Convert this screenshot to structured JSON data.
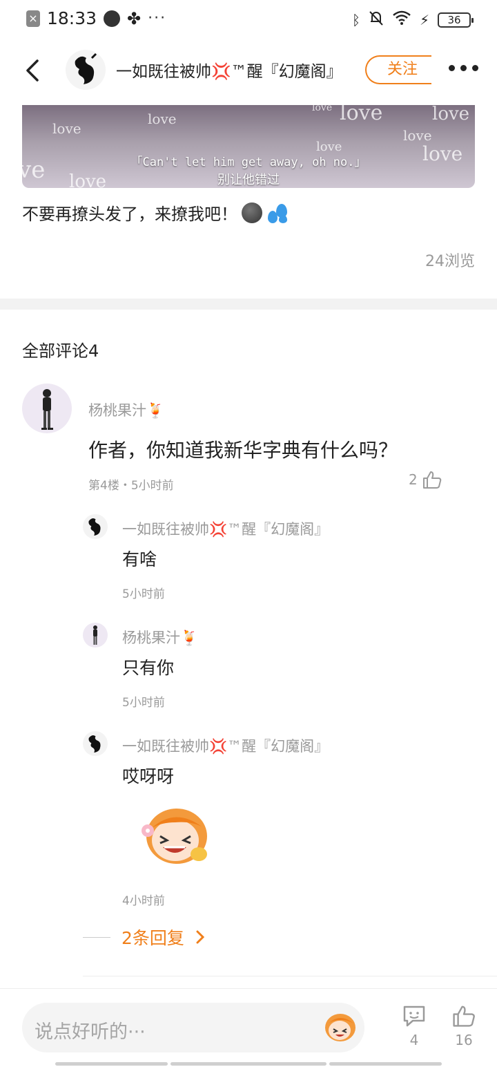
{
  "status_bar": {
    "time": "18:33",
    "battery": "36"
  },
  "header": {
    "author": "一如既往被帅💢™醒『幻魔阁』",
    "follow_label": "关注"
  },
  "post": {
    "subtitle_en": "「Can't let him get away, oh no.」",
    "subtitle_zh": "别让他错过",
    "caption": "不要再撩头发了，来撩我吧！",
    "views": "24浏览"
  },
  "comments_section": {
    "title": "全部评论4"
  },
  "comment": {
    "author": "杨桃果汁🍹",
    "text": "作者，你知道我新华字典有什么吗？",
    "meta": "第4楼・5小时前",
    "likes": "2"
  },
  "replies": [
    {
      "author": "一如既往被帅💢™醒『幻魔阁』",
      "text": "有啥",
      "time": "5小时前"
    },
    {
      "author": "杨桃果汁🍹",
      "text": "只有你",
      "time": "5小时前"
    },
    {
      "author": "一如既往被帅💢™醒『幻魔阁』",
      "text": "哎呀呀",
      "time": "4小时前"
    }
  ],
  "more_replies": "2条回复",
  "bottom_bar": {
    "input_placeholder": "说点好听的···",
    "comment_count": "4",
    "like_count": "16"
  },
  "colors": {
    "accent": "#f07f1a",
    "muted": "#9a9a9a"
  }
}
